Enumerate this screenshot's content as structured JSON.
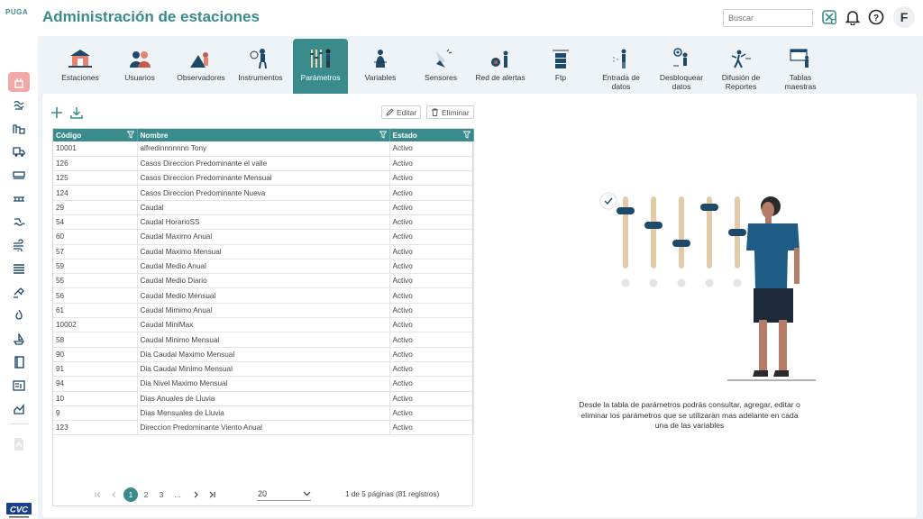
{
  "app": {
    "logo": "PUGA",
    "title": "Administración de estaciones"
  },
  "header": {
    "search_placeholder": "Buscar",
    "icons": [
      "satellite-settings-icon",
      "bell-icon",
      "help-icon"
    ],
    "avatar_letter": "F"
  },
  "colors": {
    "accent": "#3a8b8c",
    "sidebar_active": "#f3a8a8",
    "background": "#eef3f8"
  },
  "sidebar": {
    "items": [
      {
        "icon": "station-icon",
        "active": true
      },
      {
        "icon": "water-icon"
      },
      {
        "icon": "factory-icon"
      },
      {
        "icon": "truck-icon"
      },
      {
        "icon": "bus-icon"
      },
      {
        "icon": "bridge-icon"
      },
      {
        "icon": "flood-icon"
      },
      {
        "icon": "wind-icon"
      },
      {
        "icon": "layers-icon"
      },
      {
        "icon": "satellite-icon"
      },
      {
        "icon": "fire-icon"
      },
      {
        "icon": "boat-icon"
      },
      {
        "icon": "book-icon"
      },
      {
        "icon": "report-icon"
      },
      {
        "icon": "chart-icon"
      },
      {
        "icon": "pdf-icon"
      }
    ]
  },
  "tabs": [
    {
      "label": "Estaciones"
    },
    {
      "label": "Usuarios"
    },
    {
      "label": "Observadores"
    },
    {
      "label": "Instrumentos"
    },
    {
      "label": "Parámetros",
      "active": true
    },
    {
      "label": "Variables"
    },
    {
      "label": "Sensores"
    },
    {
      "label": "Red de alertas"
    },
    {
      "label": "Ftp"
    },
    {
      "label": "Entrada de\ndatos"
    },
    {
      "label": "Desbloquear\ndatos"
    },
    {
      "label": "Difusión de\nReportes"
    },
    {
      "label": "Tablas\nmaestras"
    }
  ],
  "toolbar": {
    "edit_label": "Editar",
    "delete_label": "Eliminar"
  },
  "table": {
    "columns": [
      "Código",
      "Nombre",
      "Estado"
    ],
    "rows": [
      [
        "10001",
        "alfredinnnnnnn Tony",
        "Activo"
      ],
      [
        "126",
        "Casos Direccion Predominante el valle",
        "Activo"
      ],
      [
        "125",
        "Casos Direccion Predominante Mensual",
        "Activo"
      ],
      [
        "124",
        "Casos Direccion Predominante Nueva",
        "Activo"
      ],
      [
        "29",
        "Caudal",
        "Activo"
      ],
      [
        "54",
        "Caudal HorarioSS",
        "Activo"
      ],
      [
        "60",
        "Caudal Maximo Anual",
        "Activo"
      ],
      [
        "57",
        "Caudal Maximo Mensual",
        "Activo"
      ],
      [
        "59",
        "Caudal Medio Anual",
        "Activo"
      ],
      [
        "55",
        "Caudal Medio Diario",
        "Activo"
      ],
      [
        "56",
        "Caudal Medio Mensual",
        "Activo"
      ],
      [
        "61",
        "Caudal Mimimo Anual",
        "Activo"
      ],
      [
        "10002",
        "Caudal MiniMax",
        "Activo"
      ],
      [
        "58",
        "Caudal Minimo Mensual",
        "Activo"
      ],
      [
        "90",
        "Dia Caudal Maximo Mensual",
        "Activo"
      ],
      [
        "91",
        "Dia Caudal Minimo Mensual",
        "Activo"
      ],
      [
        "94",
        "Dia Nivel Maximo Mensual",
        "Activo"
      ],
      [
        "10",
        "Dias Anuales de Lluvia",
        "Activo"
      ],
      [
        "9",
        "Dias Mensuales de Lluvia",
        "Activo"
      ],
      [
        "123",
        "Direccion Predominante Viento Anual",
        "Activo"
      ]
    ]
  },
  "pagination": {
    "pages": [
      "1",
      "2",
      "3",
      "..."
    ],
    "current": "1",
    "page_size": "20",
    "info": "1 de 5 páginas (81 registros)"
  },
  "illustration": {
    "slider_levels": [
      0.8,
      0.6,
      0.35,
      0.85,
      0.5
    ]
  },
  "description": "Desde la tabla de parámetros podrás consultar, agregar, editar o eliminar los parámetros que se utilizaran mas adelante en cada una de las variables"
}
